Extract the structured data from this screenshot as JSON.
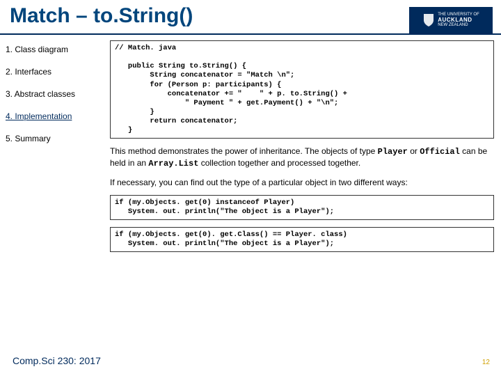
{
  "header": {
    "title": "Match – to.String()",
    "logo_top": "THE UNIVERSITY OF",
    "logo_main": "AUCKLAND",
    "logo_sub": "NEW ZEALAND"
  },
  "sidebar": {
    "items": [
      {
        "label": "1. Class diagram",
        "active": false
      },
      {
        "label": "2. Interfaces",
        "active": false
      },
      {
        "label": "3. Abstract classes",
        "active": false
      },
      {
        "label": "4. Implementation",
        "active": true
      },
      {
        "label": "5. Summary",
        "active": false
      }
    ]
  },
  "content": {
    "code1": "// Match. java\n\n   public String to.String() {\n        String concatenator = \"Match \\n\";\n        for (Person p: participants) {\n            concatenator += \"    \" + p. to.String() +\n                \" Payment \" + get.Payment() + \"\\n\";\n        }\n        return concatenator;\n   }",
    "para1a": "This method demonstrates the power of inheritance. The objects of type ",
    "para1b": "Player",
    "para1c": " or ",
    "para1d": "Official",
    "para1e": " can be held in an ",
    "para1f": "Array.List",
    "para1g": " collection together and processed together.",
    "para2": "If necessary, you can find out the type of a particular object in two different ways:",
    "code2": "if (my.Objects. get(0) instanceof Player)\n   System. out. println(\"The object is a Player\");",
    "code3": "if (my.Objects. get(0). get.Class() == Player. class)\n   System. out. println(\"The object is a Player\");"
  },
  "footer": {
    "left": "Comp.Sci 230: 2017",
    "right": "12"
  }
}
